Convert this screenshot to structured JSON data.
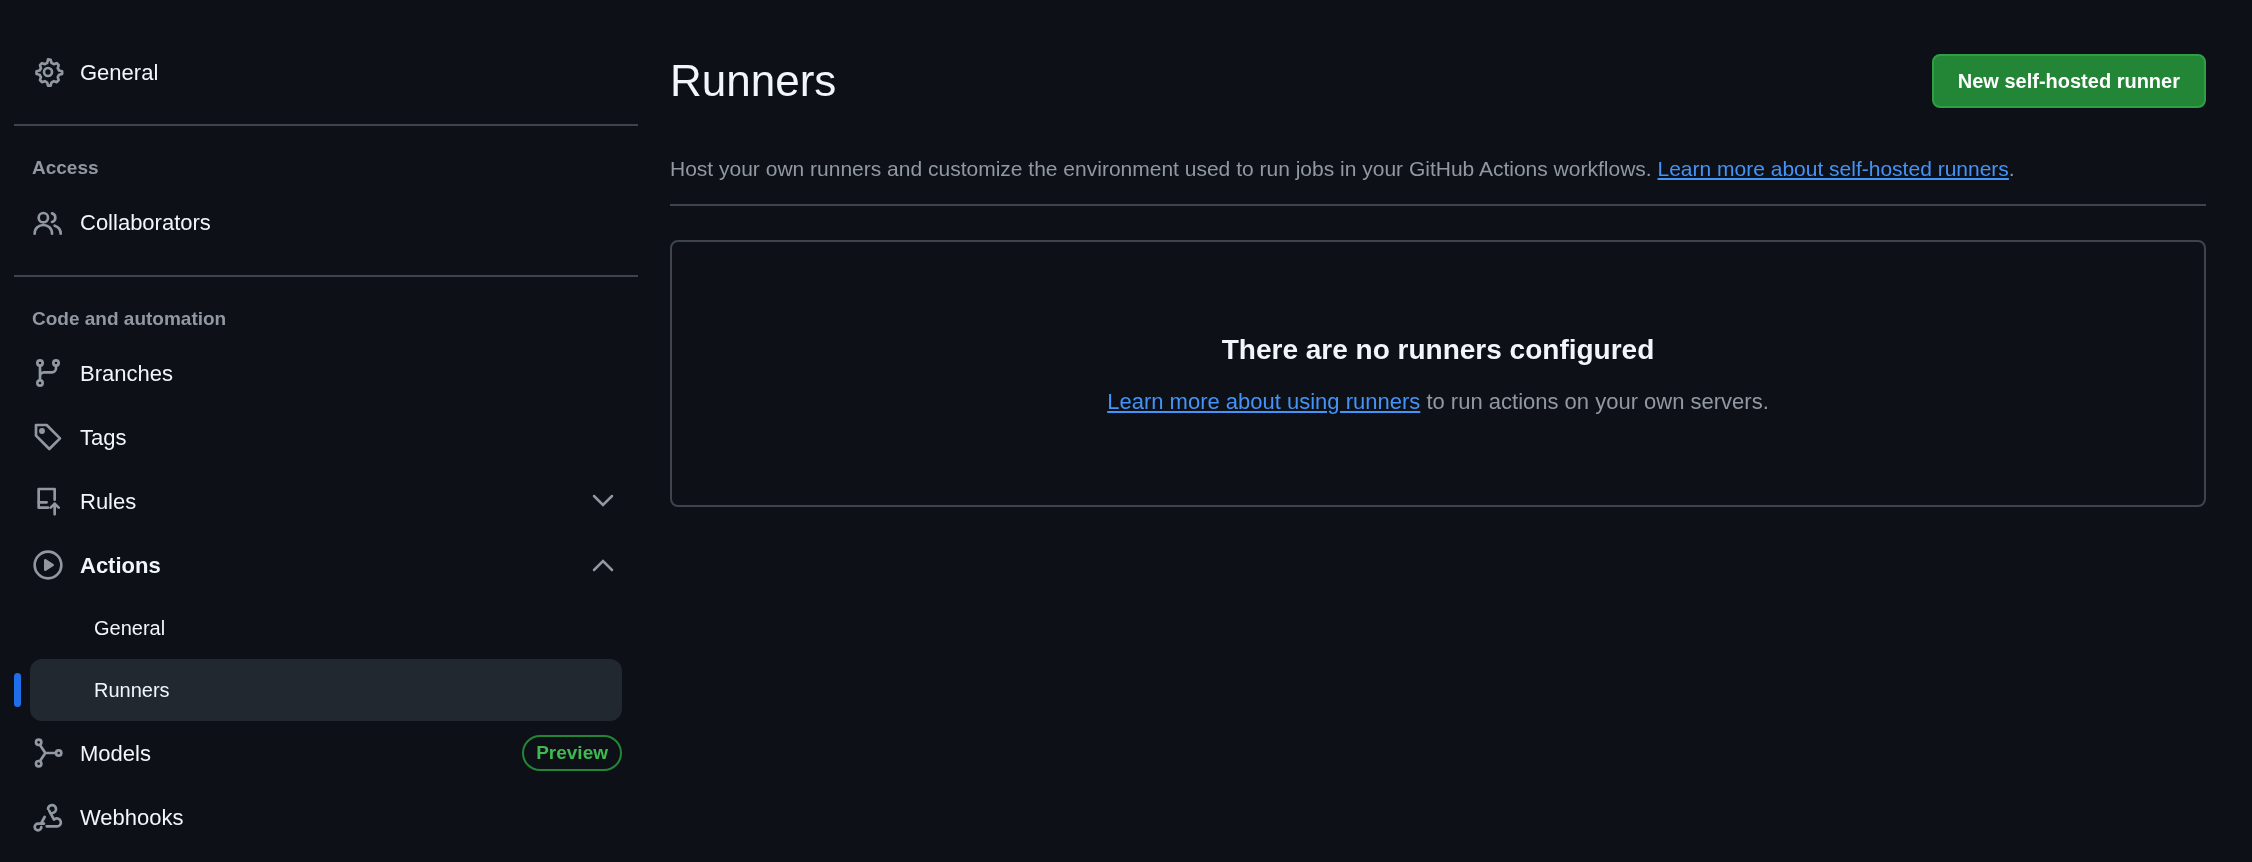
{
  "sidebar": {
    "sections": [
      {
        "items": [
          {
            "label": "General",
            "selected": false
          }
        ]
      },
      {
        "heading": "Access",
        "items": [
          {
            "label": "Collaborators",
            "selected": false
          }
        ]
      },
      {
        "heading": "Code and automation",
        "items": [
          {
            "label": "Branches",
            "selected": false
          },
          {
            "label": "Tags",
            "selected": false
          },
          {
            "label": "Rules",
            "selected": false,
            "expanded": false
          },
          {
            "label": "Actions",
            "selected": true,
            "expanded": true,
            "children": [
              {
                "label": "General",
                "selected": false
              },
              {
                "label": "Runners",
                "selected": true
              }
            ]
          },
          {
            "label": "Models",
            "selected": false,
            "badge": "Preview"
          },
          {
            "label": "Webhooks",
            "selected": false
          }
        ]
      }
    ]
  },
  "main": {
    "title": "Runners",
    "button": "New self-hosted runner",
    "description": {
      "text": "Host your own runners and customize the environment used to run jobs in your GitHub Actions workflows.",
      "link": "Learn more about self-hosted runners",
      "after": "."
    },
    "empty_state": {
      "title": "There are no runners configured",
      "link": "Learn more about using runners",
      "text": "to run actions on your own servers."
    }
  }
}
